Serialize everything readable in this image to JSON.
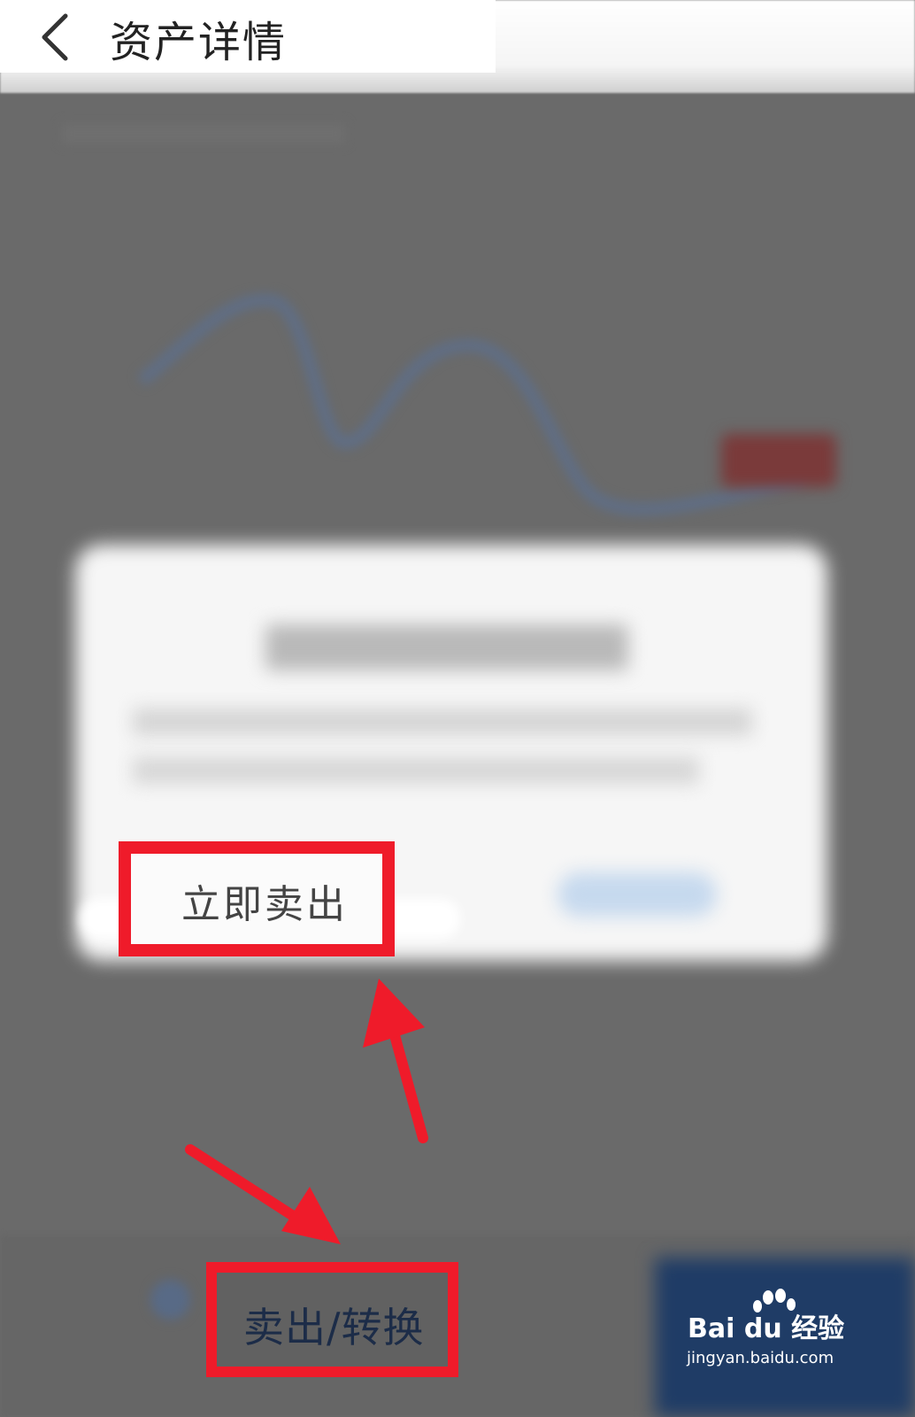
{
  "header": {
    "title": "资产详情",
    "back_icon": "chevron-left-icon"
  },
  "dialog": {
    "primary_action_label": "立即卖出"
  },
  "bottom_bar": {
    "sell_switch_label": "卖出/转换"
  },
  "annotations": {
    "highlight_color": "#ef1b2a"
  },
  "watermark": {
    "brand": "Bai du 经验",
    "url": "jingyan.baidu.com"
  }
}
